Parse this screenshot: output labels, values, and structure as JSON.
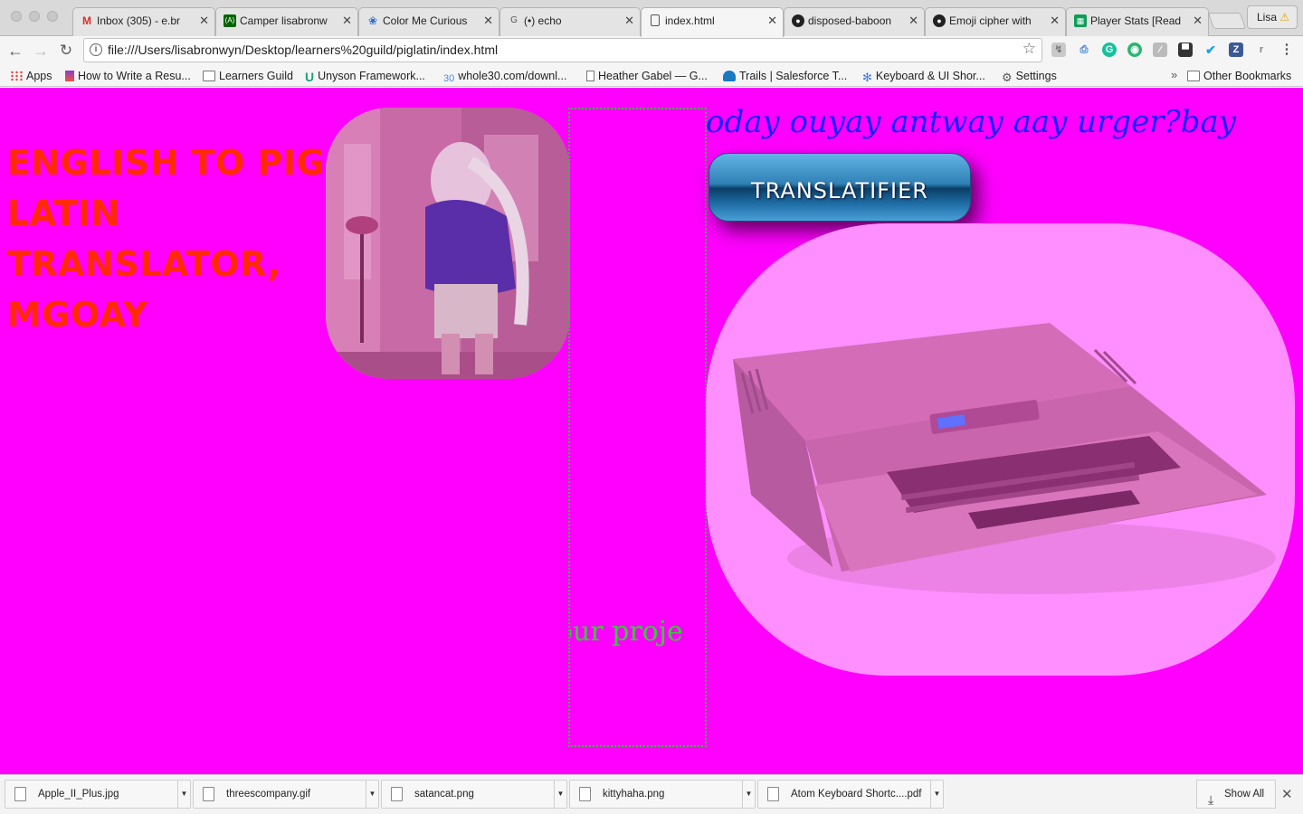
{
  "browser": {
    "tabs": [
      {
        "title": "Inbox (305) - e.br",
        "favicon": "gmail-icon",
        "active": false
      },
      {
        "title": "Camper lisabronw",
        "favicon": "fcc-icon",
        "active": false
      },
      {
        "title": "Color Me Curious",
        "favicon": "color-icon",
        "active": false
      },
      {
        "title": "(•) echo",
        "favicon": "echo-icon",
        "active": false
      },
      {
        "title": "index.html",
        "favicon": "file-icon",
        "active": true
      },
      {
        "title": "disposed-baboon",
        "favicon": "github-icon",
        "active": false
      },
      {
        "title": "Emoji cipher with",
        "favicon": "github-icon",
        "active": false
      },
      {
        "title": "Player Stats [Read",
        "favicon": "sheets-icon",
        "active": false
      }
    ],
    "profile": {
      "name": "Lisa",
      "warning_icon": "warning-icon"
    },
    "url": "file:///Users/lisabronwyn/Desktop/learners%20guild/piglatin/index.html",
    "bookmarks": [
      {
        "label": "Apps",
        "icon": "apps-grid-icon"
      },
      {
        "label": "How to Write a Resu...",
        "icon": "bookmark-page-icon"
      },
      {
        "label": "Learners Guild",
        "icon": "folder-icon"
      },
      {
        "label": "Unyson Framework...",
        "icon": "unyson-icon"
      },
      {
        "label": "whole30.com/downl...",
        "icon": "whole30-icon"
      },
      {
        "label": "Heather Gabel — G...",
        "icon": "page-icon"
      },
      {
        "label": "Trails | Salesforce T...",
        "icon": "trailhead-icon"
      },
      {
        "label": "Keyboard & UI Shor...",
        "icon": "gear-blue-icon"
      },
      {
        "label": "Settings",
        "icon": "gear-icon"
      }
    ],
    "other_bookmarks": "Other Bookmarks"
  },
  "page": {
    "heading": "ENGLISH TO PIG LATIN TRANSLATOR, MGOAY",
    "prompt_pig_latin": "oday ouyay antway aay urger?bay",
    "button_label": "TRANSLATIFIER",
    "marquee_text": "s our proje",
    "colors": {
      "background": "#ff00ff",
      "heading": "#ff2a00",
      "prompt": "#1520ff",
      "marquee": "#2fd02f"
    }
  },
  "downloads": {
    "items": [
      {
        "name": "Apple_II_Plus.jpg"
      },
      {
        "name": "threescompany.gif"
      },
      {
        "name": "satancat.png"
      },
      {
        "name": "kittyhaha.png"
      },
      {
        "name": "Atom Keyboard Shortc....pdf"
      }
    ],
    "show_all": "Show All"
  }
}
